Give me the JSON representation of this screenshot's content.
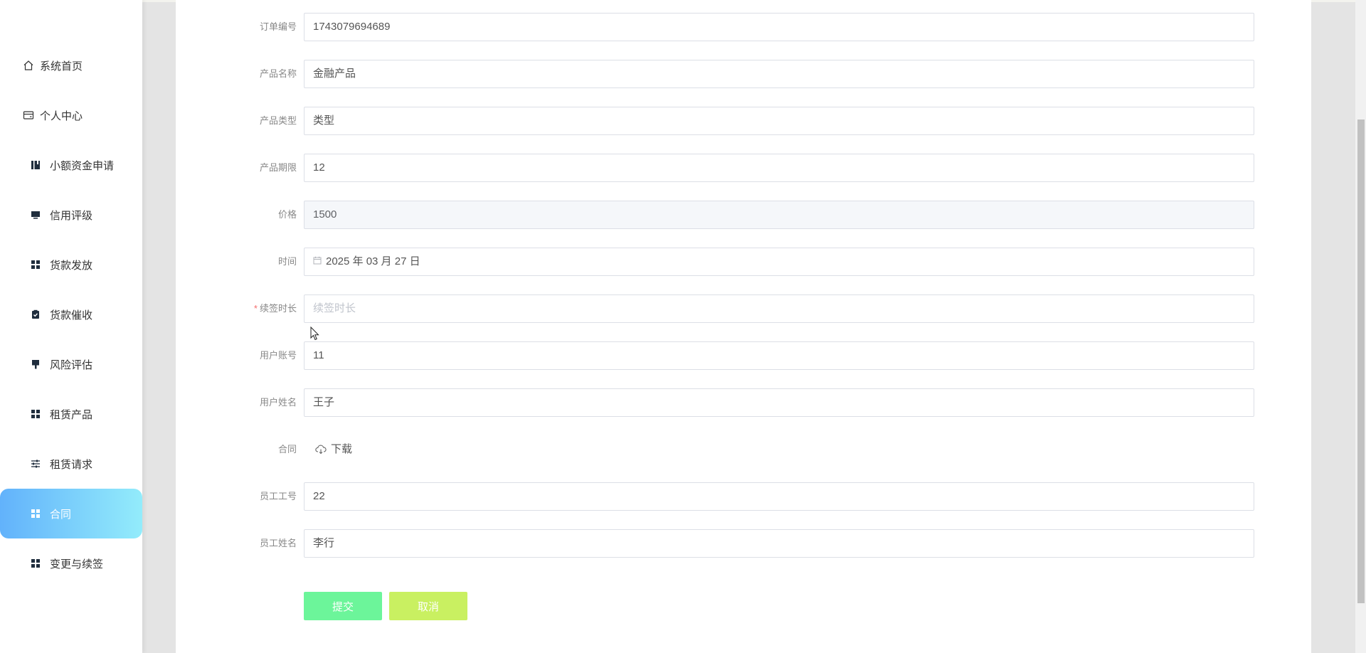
{
  "sidebar": {
    "items": [
      {
        "label": "系统首页",
        "icon": "home-icon"
      },
      {
        "label": "个人中心",
        "icon": "wallet-icon"
      },
      {
        "label": "小额资金申请",
        "icon": "book-icon"
      },
      {
        "label": "信用评级",
        "icon": "monitor-icon"
      },
      {
        "label": "货款发放",
        "icon": "grid-icon"
      },
      {
        "label": "货款催收",
        "icon": "clipboard-check-icon"
      },
      {
        "label": "风险评估",
        "icon": "brush-icon"
      },
      {
        "label": "租赁产品",
        "icon": "grid-icon"
      },
      {
        "label": "租赁请求",
        "icon": "sliders-icon"
      },
      {
        "label": "合同",
        "icon": "grid-icon",
        "active": true
      },
      {
        "label": "变更与续签",
        "icon": "grid-icon"
      }
    ],
    "active_gradient": [
      "#62b2fb",
      "#93ecfb"
    ]
  },
  "form": {
    "order_no": {
      "label": "订单编号",
      "value": "1743079694689"
    },
    "product_name": {
      "label": "产品名称",
      "value": "金融产品"
    },
    "product_type": {
      "label": "产品类型",
      "value": "类型"
    },
    "product_term": {
      "label": "产品期限",
      "value": "12"
    },
    "price": {
      "label": "价格",
      "value": "1500"
    },
    "time": {
      "label": "时间",
      "value": "2025 年 03 月 27 日"
    },
    "renew_duration": {
      "label": "续签时长",
      "required_mark": "*",
      "placeholder": "续签时长",
      "value": ""
    },
    "user_account": {
      "label": "用户账号",
      "value": "11"
    },
    "user_name": {
      "label": "用户姓名",
      "value": "王子"
    },
    "contract": {
      "label": "合同",
      "download_label": "下载"
    },
    "staff_no": {
      "label": "员工工号",
      "value": "22"
    },
    "staff_name": {
      "label": "员工姓名",
      "value": "李行"
    }
  },
  "buttons": {
    "submit": {
      "label": "提交",
      "color": "#6cf59a"
    },
    "cancel": {
      "label": "取消",
      "color": "#c9f061"
    }
  }
}
